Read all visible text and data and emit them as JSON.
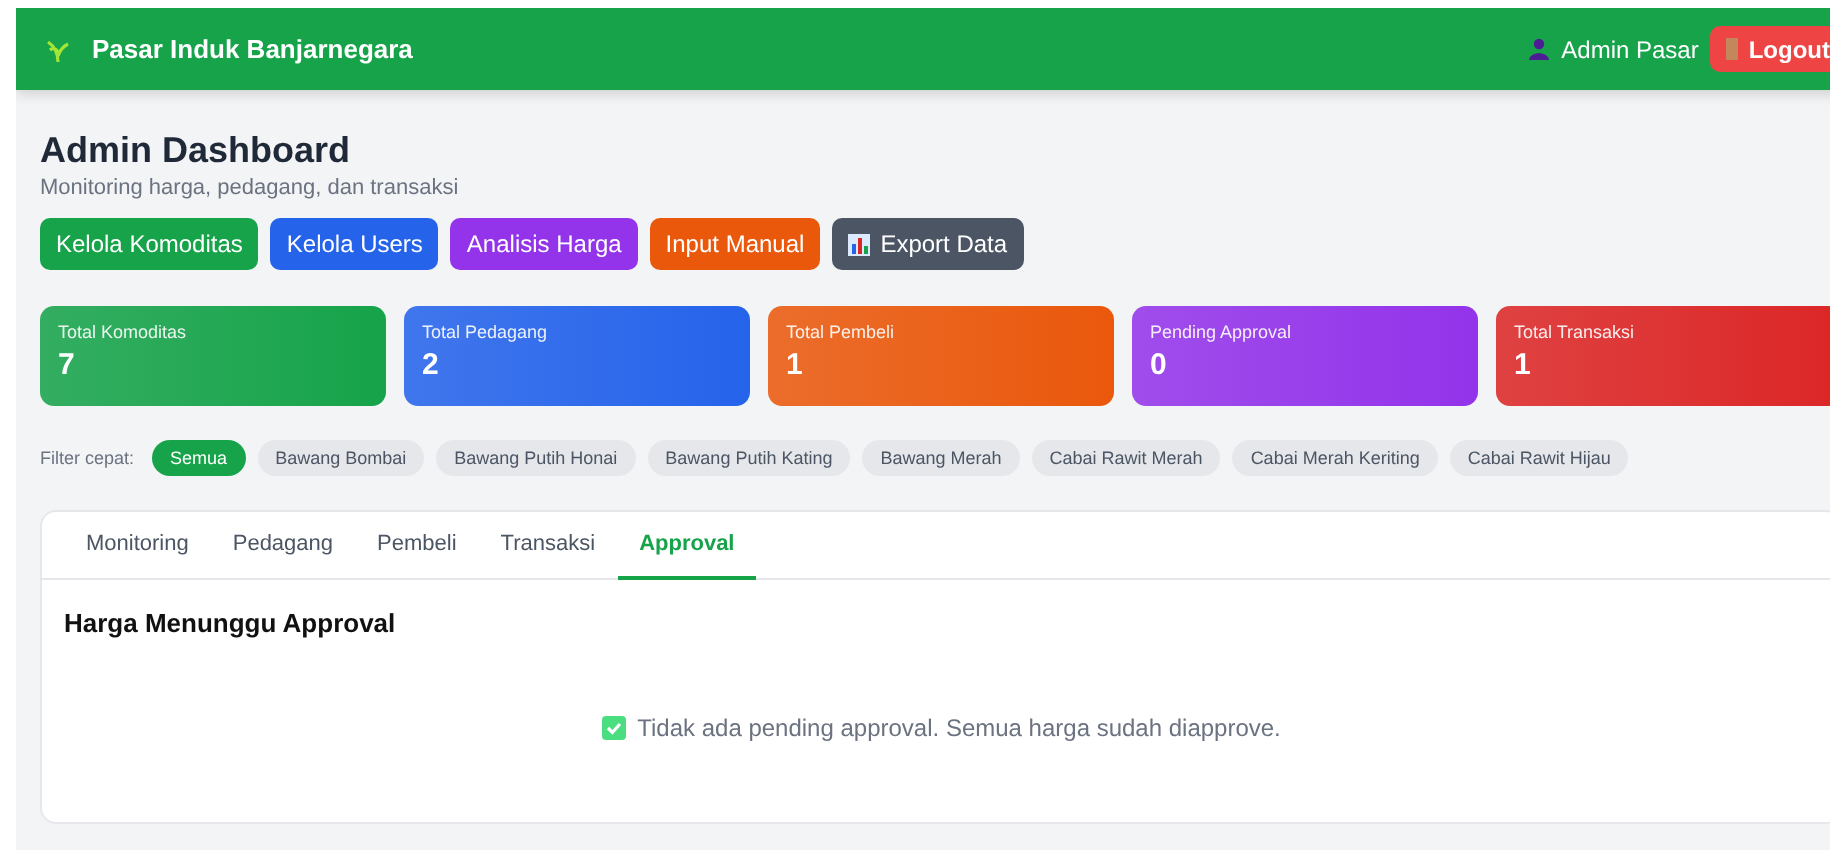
{
  "header": {
    "brand": "Pasar Induk Banjarnegara",
    "user": "Admin Pasar",
    "logout": "Logout"
  },
  "page": {
    "title": "Admin Dashboard",
    "subtitle": "Monitoring harga, pedagang, dan transaksi"
  },
  "actions": [
    {
      "label": "Kelola Komoditas",
      "color": "#16a34a",
      "kind": "plain"
    },
    {
      "label": "Kelola Users",
      "color": "#2563eb",
      "kind": "plain"
    },
    {
      "label": "Analisis Harga",
      "color": "#9333ea",
      "kind": "plain"
    },
    {
      "label": "Input Manual",
      "color": "#ea580c",
      "kind": "plain"
    },
    {
      "label": "Export Data",
      "color": "#4b5563",
      "kind": "chart"
    }
  ],
  "stats": [
    {
      "label": "Total Komoditas",
      "value": "7",
      "color": "#16a34a"
    },
    {
      "label": "Total Pedagang",
      "value": "2",
      "color": "#2563eb"
    },
    {
      "label": "Total Pembeli",
      "value": "1",
      "color": "#ea580c"
    },
    {
      "label": "Pending Approval",
      "value": "0",
      "color": "#9333ea"
    },
    {
      "label": "Total Transaksi",
      "value": "1",
      "color": "#dc2626"
    }
  ],
  "filter": {
    "label": "Filter cepat:",
    "chips": [
      {
        "label": "Semua",
        "selected": true
      },
      {
        "label": "Bawang Bombai",
        "selected": false
      },
      {
        "label": "Bawang Putih Honai",
        "selected": false
      },
      {
        "label": "Bawang Putih Kating",
        "selected": false
      },
      {
        "label": "Bawang Merah",
        "selected": false
      },
      {
        "label": "Cabai Rawit Merah",
        "selected": false
      },
      {
        "label": "Cabai Merah Keriting",
        "selected": false
      },
      {
        "label": "Cabai Rawit Hijau",
        "selected": false
      }
    ]
  },
  "tabs": [
    {
      "label": "Monitoring",
      "selected": false
    },
    {
      "label": "Pedagang",
      "selected": false
    },
    {
      "label": "Pembeli",
      "selected": false
    },
    {
      "label": "Transaksi",
      "selected": false
    },
    {
      "label": "Approval",
      "selected": true
    }
  ],
  "panel": {
    "heading": "Harga Menunggu Approval",
    "message": "Tidak ada pending approval. Semua harga sudah diapprove."
  }
}
